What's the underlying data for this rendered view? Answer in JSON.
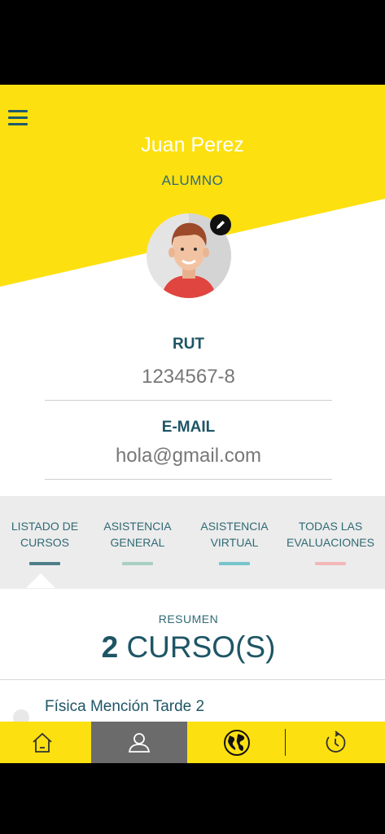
{
  "profile": {
    "name": "Juan Perez",
    "role": "ALUMNO"
  },
  "fields": {
    "rut_label": "RUT",
    "rut_value": "1234567-8",
    "email_label": "E-MAIL",
    "email_value": "hola@gmail.com"
  },
  "tabs": [
    {
      "line1": "LISTADO DE",
      "line2": "CURSOS",
      "color": "#4e7f88",
      "active": true
    },
    {
      "line1": "ASISTENCIA",
      "line2": "GENERAL",
      "color": "#a9cfc2",
      "active": false
    },
    {
      "line1": "ASISTENCIA",
      "line2": "VIRTUAL",
      "color": "#76c4cc",
      "active": false
    },
    {
      "line1": "TODAS LAS",
      "line2": "EVALUACIONES",
      "color": "#f2b8b8",
      "active": false
    }
  ],
  "summary": {
    "label": "RESUMEN",
    "count": "2",
    "unit": "CURSO(S)"
  },
  "courses": [
    {
      "name": "Física Mención Tarde 2"
    }
  ],
  "bottom_nav": [
    {
      "icon": "home-icon",
      "active": false
    },
    {
      "icon": "user-icon",
      "active": true
    },
    {
      "icon": "globe-icon",
      "active": false
    },
    {
      "icon": "history-icon",
      "active": false
    }
  ],
  "colors": {
    "brand_yellow": "#fde010",
    "primary_teal": "#1e5565",
    "active_nav": "#6b6b6b"
  }
}
